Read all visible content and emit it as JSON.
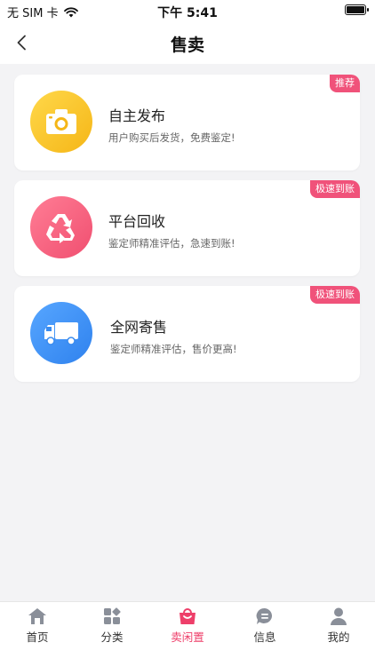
{
  "status_bar": {
    "carrier": "无 SIM 卡",
    "time": "下午 5:41"
  },
  "nav": {
    "title": "售卖"
  },
  "cards": [
    {
      "title": "自主发布",
      "desc": "用户购买后发货，免费鉴定!",
      "badge": "推荐",
      "icon": "camera-icon",
      "color": "#f7c11f"
    },
    {
      "title": "平台回收",
      "desc": "鉴定师精准评估，急速到账!",
      "badge": "极速到账",
      "icon": "recycle-icon",
      "color": "#f25b7b"
    },
    {
      "title": "全网寄售",
      "desc": "鉴定师精准评估，售价更高!",
      "badge": "极速到账",
      "icon": "truck-icon",
      "color": "#3a8cf0"
    }
  ],
  "tabs": [
    {
      "label": "首页",
      "icon": "home-icon",
      "active": false
    },
    {
      "label": "分类",
      "icon": "category-icon",
      "active": false
    },
    {
      "label": "卖闲置",
      "icon": "shopping-bag-icon",
      "active": true
    },
    {
      "label": "信息",
      "icon": "message-icon",
      "active": false
    },
    {
      "label": "我的",
      "icon": "user-icon",
      "active": false
    }
  ],
  "colors": {
    "accent": "#ee3f6a",
    "badge": "#f0527a",
    "background": "#f3f3f5"
  }
}
